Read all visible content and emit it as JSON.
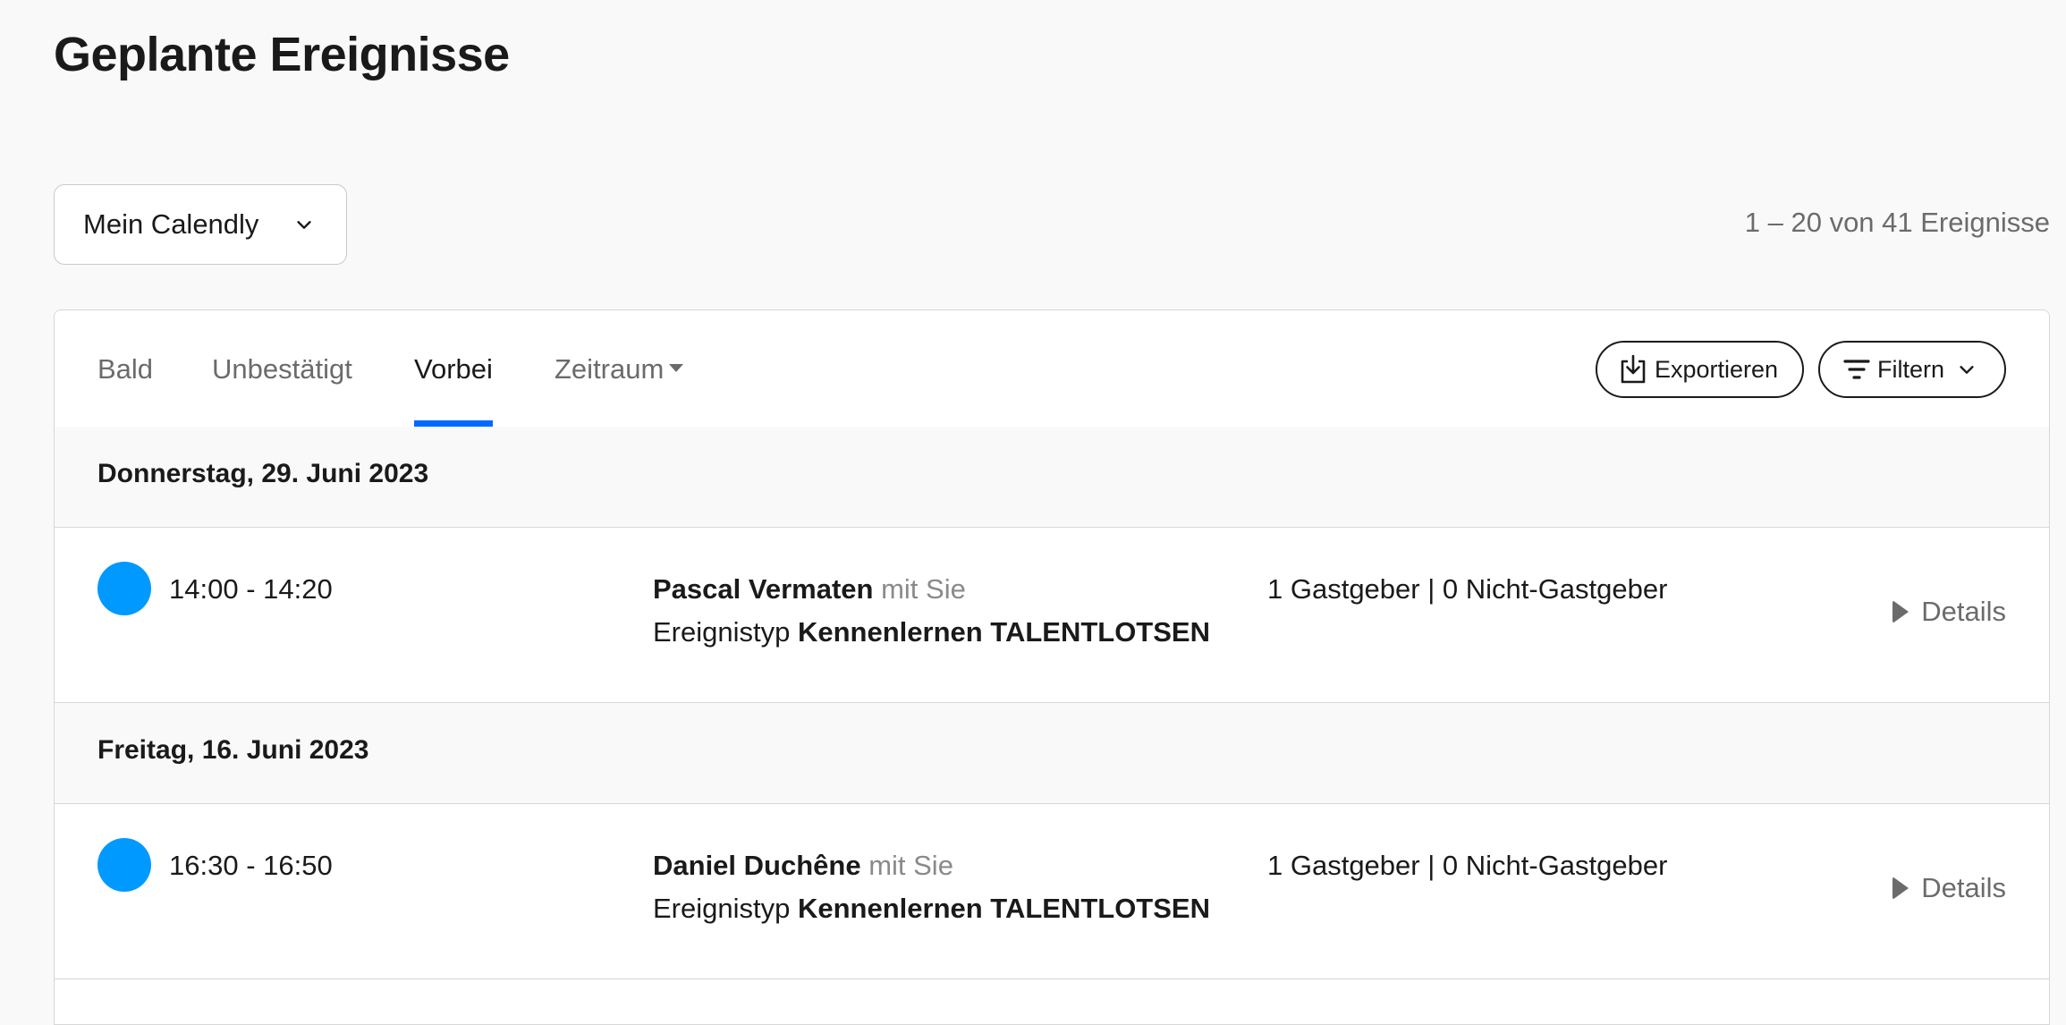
{
  "page": {
    "title": "Geplante Ereignisse"
  },
  "calendar_select": {
    "value": "Mein Calendly"
  },
  "event_count": "1 – 20 von 41 Ereignisse",
  "tabs": [
    {
      "label": "Bald",
      "active": false
    },
    {
      "label": "Unbestätigt",
      "active": false
    },
    {
      "label": "Vorbei",
      "active": true
    },
    {
      "label": "Zeitraum",
      "active": false,
      "has_caret": true
    }
  ],
  "actions": {
    "export_label": "Exportieren",
    "filter_label": "Filtern"
  },
  "days": [
    {
      "date_label": "Donnerstag, 29. Juni 2023",
      "events": [
        {
          "time": "14:00 - 14:20",
          "color": "#0099ff",
          "invitee": "Pascal Vermaten",
          "with_text": "mit Sie",
          "type_prefix": "Ereignistyp",
          "type_name": "Kennenlernen TALENTLOTSEN",
          "hosts": "1 Gastgeber | 0 Nicht-Gastgeber",
          "details_label": "Details"
        }
      ]
    },
    {
      "date_label": "Freitag, 16. Juni 2023",
      "events": [
        {
          "time": "16:30 - 16:50",
          "color": "#0099ff",
          "invitee": "Daniel Duchêne",
          "with_text": "mit Sie",
          "type_prefix": "Ereignistyp",
          "type_name": "Kennenlernen TALENTLOTSEN",
          "hosts": "1 Gastgeber | 0 Nicht-Gastgeber",
          "details_label": "Details"
        }
      ]
    }
  ],
  "colors": {
    "accent": "#0069ff",
    "event_dot": "#0099ff"
  }
}
